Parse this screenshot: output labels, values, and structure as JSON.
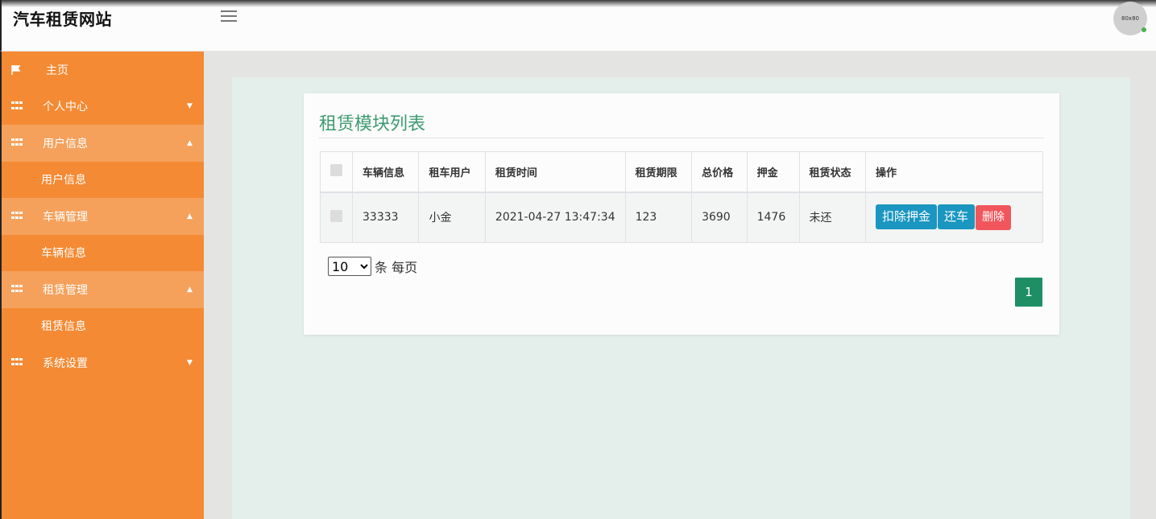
{
  "header": {
    "site_title": "汽车租赁网站",
    "avatar_text": "80x80"
  },
  "sidebar": {
    "items": [
      {
        "label": "主页",
        "icon": "flag-icon"
      },
      {
        "label": "个人中心",
        "icon": "grid-icon"
      },
      {
        "label": "用户信息",
        "icon": "grid-icon"
      },
      {
        "label": "用户信息"
      },
      {
        "label": "车辆管理",
        "icon": "grid-icon"
      },
      {
        "label": "车辆信息"
      },
      {
        "label": "租赁管理",
        "icon": "grid-icon"
      },
      {
        "label": "租赁信息"
      },
      {
        "label": "系统设置",
        "icon": "grid-icon"
      }
    ]
  },
  "main": {
    "title": "租赁模块列表",
    "columns": [
      "车辆信息",
      "租车用户",
      "租赁时间",
      "租赁期限",
      "总价格",
      "押金",
      "租赁状态",
      "操作"
    ],
    "rows": [
      {
        "vehicle": "33333",
        "user": "小金",
        "time": "2021-04-27 13:47:34",
        "term": "123",
        "total": "3690",
        "deposit": "1476",
        "status": "未还"
      }
    ],
    "actions": {
      "deduct": "扣除押金",
      "return": "还车",
      "delete": "删除"
    },
    "pager": {
      "page_size": "10",
      "page_size_suffix": "条 每页",
      "current_page": "1"
    }
  },
  "colors": {
    "sidebar": "#f48a33",
    "sidebar_open": "#f5a15c",
    "title": "#3f9a72",
    "btn_blue": "#1a96c0",
    "btn_red": "#f0565c",
    "page_btn": "#1f8e65"
  }
}
